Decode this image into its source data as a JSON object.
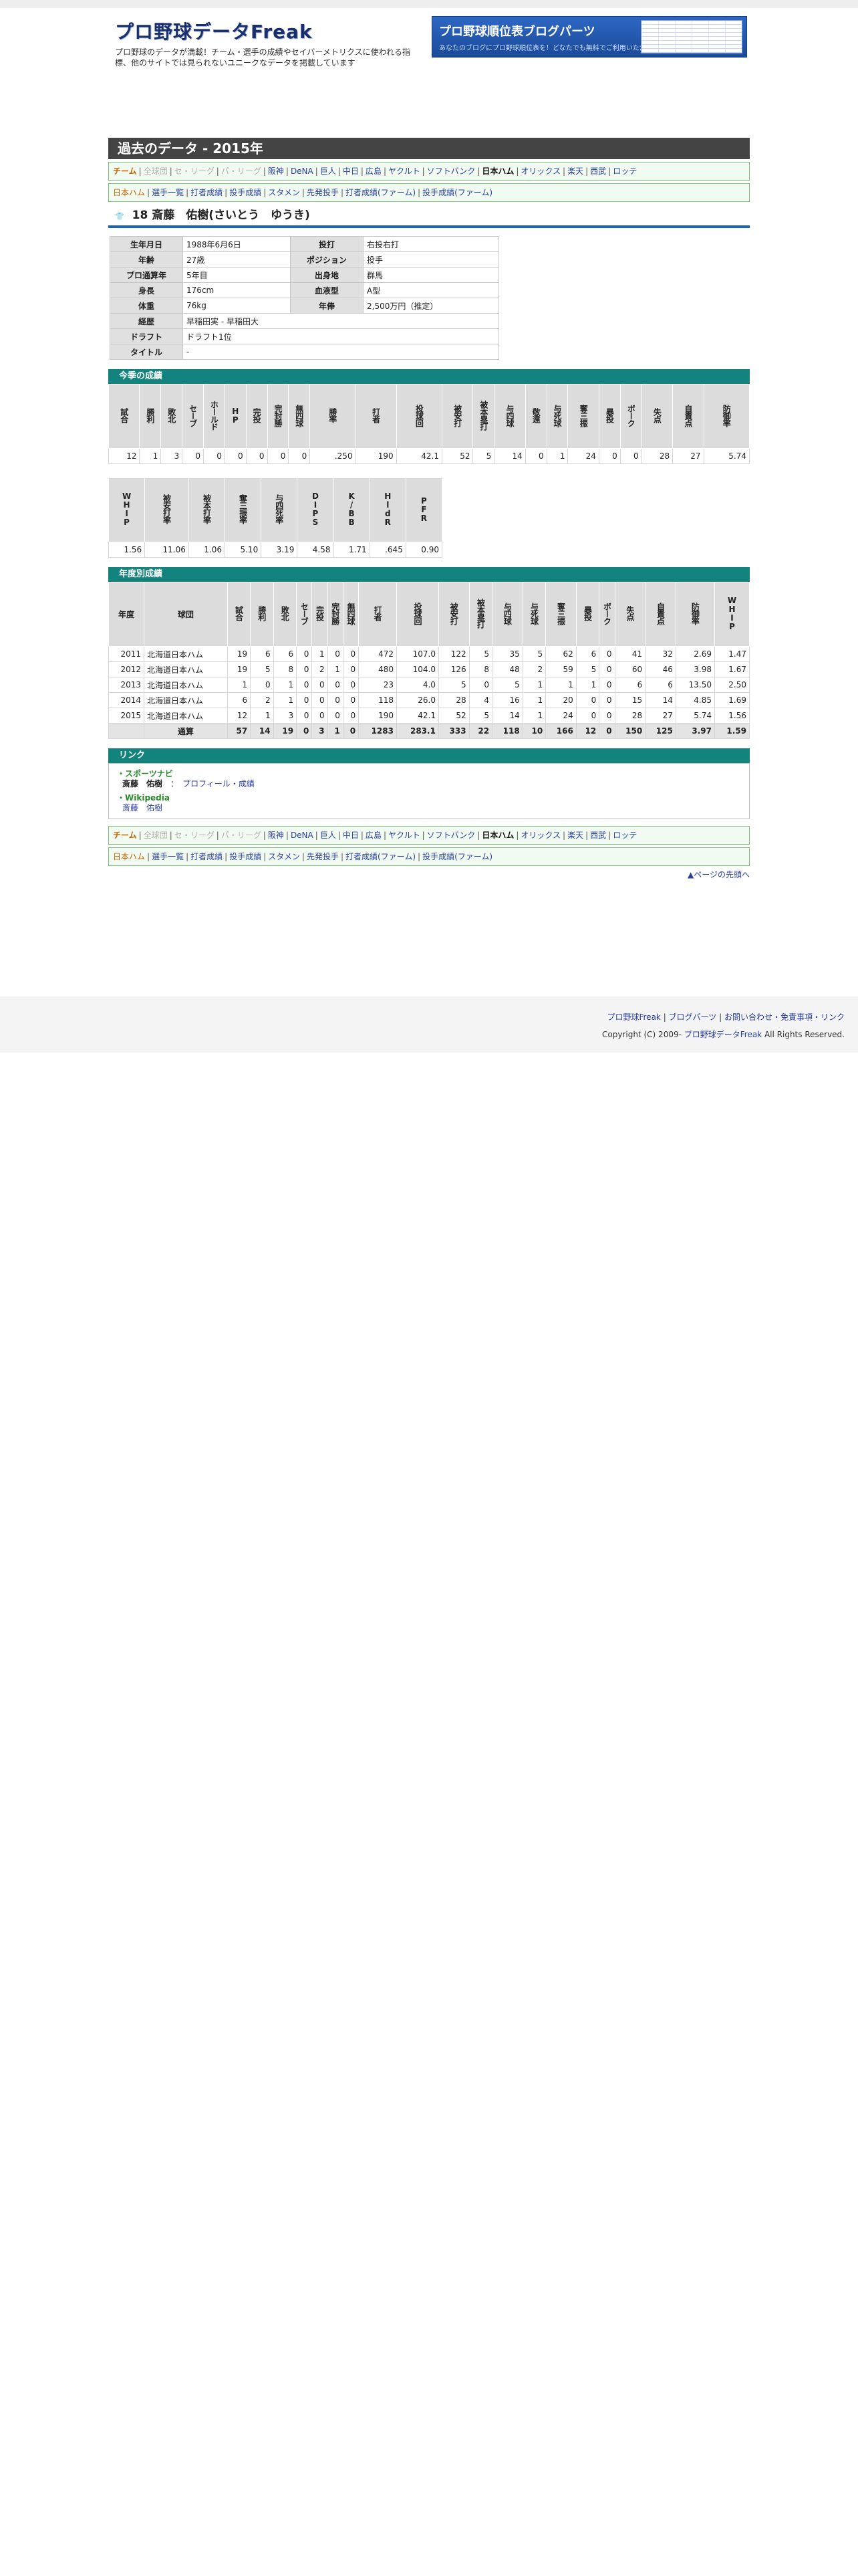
{
  "header": {
    "logo": "プロ野球データFreak",
    "desc": "プロ野球のデータが満載！チーム・選手の成績やセイバーメトリクスに使われる指標、他のサイトでは見られないユニークなデータを掲載しています",
    "banner_title": "プロ野球順位表ブログパーツ",
    "banner_sub": "あなたのブログにプロ野球順位表を！どなたでも無料でご利用いただけます"
  },
  "page_title": "過去のデータ - 2015年",
  "nav_teams": {
    "label": "チーム",
    "all": "全球団",
    "central": "セ・リーグ",
    "pacific": "パ・リーグ",
    "teams": [
      "阪神",
      "DeNA",
      "巨人",
      "中日",
      "広島",
      "ヤクルト",
      "ソフトバンク",
      "日本ハム",
      "オリックス",
      "楽天",
      "西武",
      "ロッテ"
    ],
    "current": "日本ハム"
  },
  "nav_sub": {
    "team": "日本ハム",
    "items": [
      "選手一覧",
      "打者成績",
      "投手成績",
      "スタメン",
      "先発投手",
      "打者成績(ファーム)",
      "投手成績(ファーム)"
    ]
  },
  "player": {
    "uni_icon": "uniform-icon",
    "number": "18",
    "name": "斎藤　佑樹(さいとう　ゆうき)"
  },
  "profile": {
    "birth_k": "生年月日",
    "birth_v": "1988年6月6日",
    "throw_k": "投打",
    "throw_v": "右投右打",
    "age_k": "年齢",
    "age_v": "27歳",
    "pos_k": "ポジション",
    "pos_v": "投手",
    "year_k": "プロ通算年",
    "year_v": "5年目",
    "from_k": "出身地",
    "from_v": "群馬",
    "height_k": "身長",
    "height_v": "176cm",
    "blood_k": "血液型",
    "blood_v": "A型",
    "weight_k": "体重",
    "weight_v": "76kg",
    "salary_k": "年俸",
    "salary_v": "2,500万円（推定）",
    "career_k": "経歴",
    "career_v": "早稲田実 - 早稲田大",
    "draft_k": "ドラフト",
    "draft_v": "ドラフト1位",
    "title_k": "タイトル",
    "title_v": "-"
  },
  "this_year": {
    "heading": "今季の成績",
    "headers": [
      "試合",
      "勝利",
      "敗北",
      "セーブ",
      "ホールド",
      "HP",
      "完投",
      "完封勝",
      "無四球",
      "勝率",
      "打者",
      "投球回",
      "被安打",
      "被本塁打",
      "与四球",
      "敬遠",
      "与死球",
      "奪三振",
      "暴投",
      "ボーク",
      "失点",
      "自責点",
      "防御率"
    ],
    "values": [
      "12",
      "1",
      "3",
      "0",
      "0",
      "0",
      "0",
      "0",
      "0",
      ".250",
      "190",
      "42.1",
      "52",
      "5",
      "14",
      "0",
      "1",
      "24",
      "0",
      "0",
      "28",
      "27",
      "5.74"
    ],
    "headers2": [
      "WHIP",
      "被安打率",
      "被本打率",
      "奪三振率",
      "与四死率",
      "DIPS",
      "K/BB",
      "HldR",
      "PFR"
    ],
    "values2": [
      "1.56",
      "11.06",
      "1.06",
      "5.10",
      "3.19",
      "4.58",
      "1.71",
      ".645",
      "0.90"
    ]
  },
  "yearly": {
    "heading": "年度別成績",
    "headers": [
      "年度",
      "球団",
      "試合",
      "勝利",
      "敗北",
      "セーブ",
      "完投",
      "完封勝",
      "無四球",
      "打者",
      "投球回",
      "被安打",
      "被本塁打",
      "与四球",
      "与死球",
      "奪三振",
      "暴投",
      "ボーク",
      "失点",
      "自責点",
      "防御率",
      "WHIP"
    ],
    "rows": [
      [
        "2011",
        "北海道日本ハム",
        "19",
        "6",
        "6",
        "0",
        "1",
        "0",
        "0",
        "472",
        "107.0",
        "122",
        "5",
        "35",
        "5",
        "62",
        "6",
        "0",
        "41",
        "32",
        "2.69",
        "1.47"
      ],
      [
        "2012",
        "北海道日本ハム",
        "19",
        "5",
        "8",
        "0",
        "2",
        "1",
        "0",
        "480",
        "104.0",
        "126",
        "8",
        "48",
        "2",
        "59",
        "5",
        "0",
        "60",
        "46",
        "3.98",
        "1.67"
      ],
      [
        "2013",
        "北海道日本ハム",
        "1",
        "0",
        "1",
        "0",
        "0",
        "0",
        "0",
        "23",
        "4.0",
        "5",
        "0",
        "5",
        "1",
        "1",
        "1",
        "0",
        "6",
        "6",
        "13.50",
        "2.50"
      ],
      [
        "2014",
        "北海道日本ハム",
        "6",
        "2",
        "1",
        "0",
        "0",
        "0",
        "0",
        "118",
        "26.0",
        "28",
        "4",
        "16",
        "1",
        "20",
        "0",
        "0",
        "15",
        "14",
        "4.85",
        "1.69"
      ],
      [
        "2015",
        "北海道日本ハム",
        "12",
        "1",
        "3",
        "0",
        "0",
        "0",
        "0",
        "190",
        "42.1",
        "52",
        "5",
        "14",
        "1",
        "24",
        "0",
        "0",
        "28",
        "27",
        "5.74",
        "1.56"
      ]
    ],
    "total": [
      "",
      "通算",
      "57",
      "14",
      "19",
      "0",
      "3",
      "1",
      "0",
      "1283",
      "283.1",
      "333",
      "22",
      "118",
      "10",
      "166",
      "12",
      "0",
      "150",
      "125",
      "3.97",
      "1.59"
    ]
  },
  "links": {
    "heading": "リンク",
    "src1": "・スポーツナビ",
    "player1": "斎藤　佑樹",
    "colon": "：",
    "link1": "プロフィール・成績",
    "src2": "・Wikipedia",
    "link2": "斎藤　佑樹"
  },
  "totop": "▲ページの先頭へ",
  "footer": {
    "links": [
      "プロ野球Freak",
      "ブログパーツ",
      "お問い合わせ・免責事項・リンク"
    ],
    "copy_pre": "Copyright (C) 2009-",
    "copy_link": "プロ野球データFreak",
    "copy_post": "All Rights Reserved."
  }
}
